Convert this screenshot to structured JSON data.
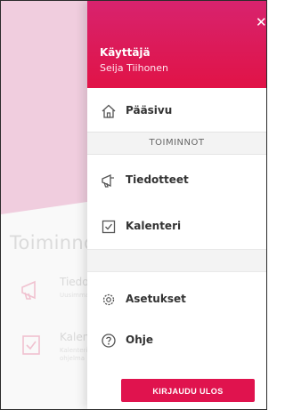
{
  "background": {
    "section_title": "Toiminnot",
    "items": [
      {
        "title": "Tiedotteet",
        "subtitle_line1": "Uusimmat",
        "subtitle_line2": ""
      },
      {
        "title": "Kalenteri",
        "subtitle_line1": "Kalenteri",
        "subtitle_line2": "ohjelma"
      }
    ]
  },
  "drawer": {
    "header": {
      "user_label": "Käyttäjä",
      "user_name": "Seija Tiihonen",
      "close_icon": "close-icon"
    },
    "home": {
      "label": "Pääsivu",
      "icon": "home-icon"
    },
    "section_title": "TOIMINNOT",
    "actions": [
      {
        "label": "Tiedotteet",
        "icon": "megaphone-icon"
      },
      {
        "label": "Kalenteri",
        "icon": "calendar-check-icon"
      }
    ],
    "settings": [
      {
        "label": "Asetukset",
        "icon": "gear-icon"
      },
      {
        "label": "Ohje",
        "icon": "help-icon"
      }
    ],
    "logout_label": "KIRJAUDU ULOS"
  },
  "colors": {
    "accent": "#e0134e",
    "header_top": "#d8236e",
    "background_hero": "#e9b3cc"
  }
}
